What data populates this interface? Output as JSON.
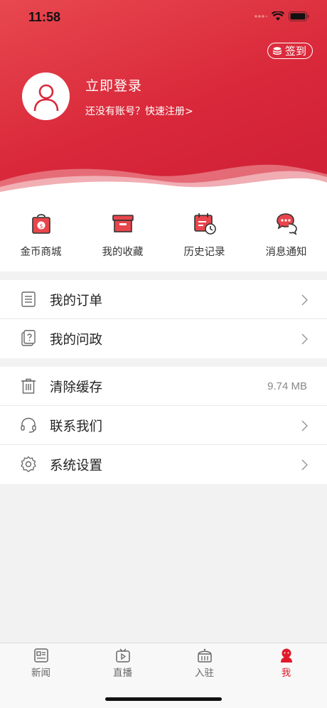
{
  "status_bar": {
    "time": "11:58"
  },
  "header": {
    "checkin_label": "签到",
    "login_title": "立即登录",
    "login_subtitle": "还没有账号？快速注册>"
  },
  "quick_actions": [
    {
      "label": "金币商城",
      "icon": "coin-bag-icon"
    },
    {
      "label": "我的收藏",
      "icon": "archive-box-icon"
    },
    {
      "label": "历史记录",
      "icon": "calendar-clock-icon"
    },
    {
      "label": "消息通知",
      "icon": "chat-bubble-icon"
    }
  ],
  "menu_group_1": [
    {
      "label": "我的订单",
      "icon": "order-list-icon"
    },
    {
      "label": "我的问政",
      "icon": "question-doc-icon"
    }
  ],
  "menu_group_2": [
    {
      "label": "清除缓存",
      "icon": "trash-icon",
      "value": "9.74 MB"
    },
    {
      "label": "联系我们",
      "icon": "headset-icon"
    },
    {
      "label": "系统设置",
      "icon": "gear-icon"
    }
  ],
  "tabbar": [
    {
      "label": "新闻",
      "icon": "news-icon",
      "active": false
    },
    {
      "label": "直播",
      "icon": "tv-icon",
      "active": false
    },
    {
      "label": "入驻",
      "icon": "building-icon",
      "active": false
    },
    {
      "label": "我",
      "icon": "profile-icon",
      "active": true
    }
  ],
  "colors": {
    "brand_red": "#e01a2c",
    "header_red": "#d9283a"
  }
}
